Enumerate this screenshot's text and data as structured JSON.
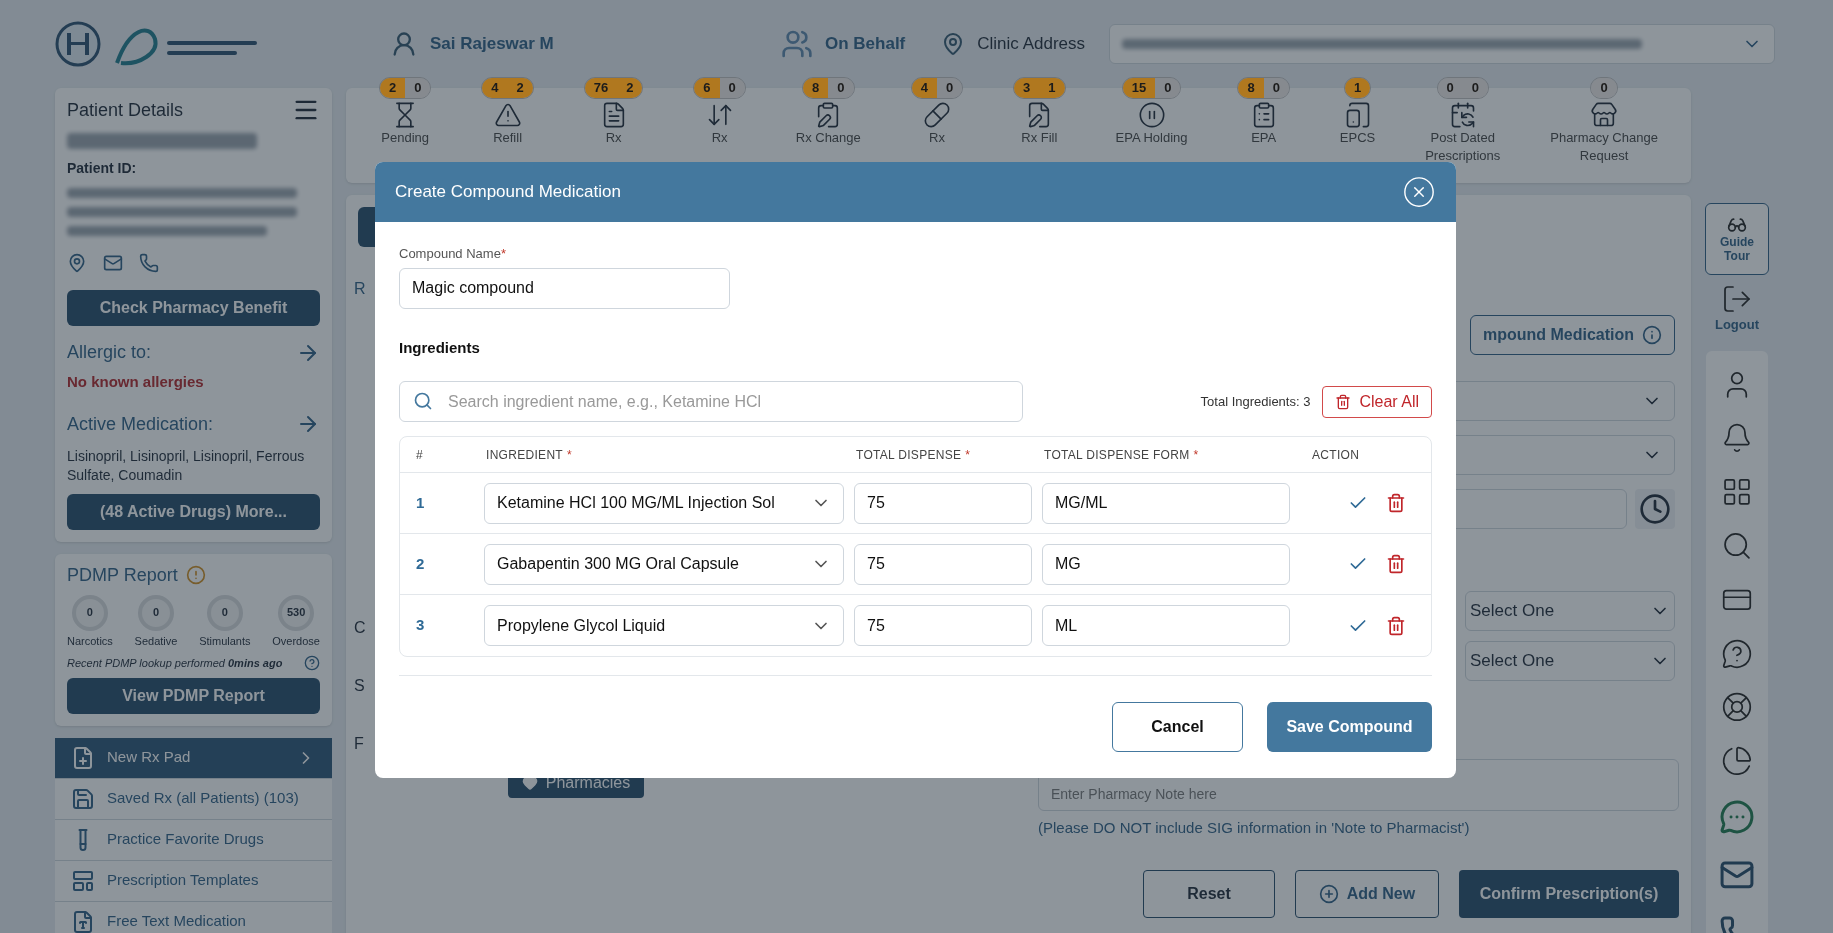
{
  "header": {
    "user": "Sai Rajeswar M",
    "on_behalf": "On Behalf",
    "clinic_label": "Clinic Address"
  },
  "toolbar": [
    {
      "lines": [
        "Pending"
      ],
      "badges": [
        {
          "value": "2",
          "color": "#b0781f"
        },
        {
          "value": "0",
          "color": "#868a8f"
        }
      ]
    },
    {
      "lines": [
        "Refill"
      ],
      "badges": [
        {
          "value": "4",
          "color": "#b0781f"
        },
        {
          "value": "2",
          "color": "#b0781f"
        }
      ]
    },
    {
      "lines": [
        "Rx"
      ],
      "badges": [
        {
          "value": "76",
          "color": "#b0781f"
        },
        {
          "value": "2",
          "color": "#b0781f"
        }
      ]
    },
    {
      "lines": [
        "Rx"
      ],
      "badges": [
        {
          "value": "6",
          "color": "#b0781f"
        },
        {
          "value": "0",
          "color": "#868a8f"
        }
      ]
    },
    {
      "lines": [
        "Rx Change"
      ],
      "badges": [
        {
          "value": "8",
          "color": "#b0781f"
        },
        {
          "value": "0",
          "color": "#868a8f"
        }
      ]
    },
    {
      "lines": [
        "Rx"
      ],
      "badges": [
        {
          "value": "4",
          "color": "#b0781f"
        },
        {
          "value": "0",
          "color": "#868a8f"
        }
      ]
    },
    {
      "lines": [
        "Rx Fill"
      ],
      "badges": [
        {
          "value": "3",
          "color": "#b0781f"
        },
        {
          "value": "1",
          "color": "#b0781f"
        }
      ]
    },
    {
      "lines": [
        "EPA Holding"
      ],
      "badges": [
        {
          "value": "15",
          "color": "#b0781f"
        },
        {
          "value": "0",
          "color": "#868a8f"
        }
      ]
    },
    {
      "lines": [
        "EPA"
      ],
      "badges": [
        {
          "value": "8",
          "color": "#b0781f"
        },
        {
          "value": "0",
          "color": "#868a8f"
        }
      ]
    },
    {
      "lines": [
        "EPCS"
      ],
      "badges": [
        {
          "value": "1",
          "color": "#b0781f"
        }
      ]
    },
    {
      "lines": [
        "Post Dated",
        "Prescriptions"
      ],
      "badges": [
        {
          "value": "0",
          "color": "#868a8f"
        },
        {
          "value": "0",
          "color": "#868a8f"
        }
      ]
    },
    {
      "lines": [
        "Pharmacy Change",
        "Request"
      ],
      "badges": [
        {
          "value": "0",
          "color": "#868a8f"
        }
      ]
    }
  ],
  "patient": {
    "title": "Patient Details",
    "id_label": "Patient ID:",
    "pharmacy_benefit": "Check Pharmacy Benefit",
    "allergic_label": "Allergic to:",
    "allergies": "No known allergies",
    "active_label": "Active Medication:",
    "medications": "Lisinopril, Lisinopril, Lisinopril, Ferrous Sulfate, Coumadin",
    "more": "(48 Active Drugs) More..."
  },
  "pdmp": {
    "title": "PDMP Report",
    "counters": [
      {
        "value": "0",
        "label": "Narcotics"
      },
      {
        "value": "0",
        "label": "Sedative"
      },
      {
        "value": "0",
        "label": "Stimulants"
      },
      {
        "value": "530",
        "label": "Overdose"
      }
    ],
    "lookup": "Recent PDMP lookup performed **0mins ago**",
    "button": "View PDMP Report"
  },
  "menu": [
    {
      "label": "New Rx Pad",
      "selected": true
    },
    {
      "label": "Saved Rx (all Patients) (103)",
      "selected": false
    },
    {
      "label": "Practice Favorite Drugs",
      "selected": false
    },
    {
      "label": "Prescription Templates",
      "selected": false
    },
    {
      "label": "Free Text Medication",
      "selected": false
    }
  ],
  "form": {
    "tab_fragment": "R",
    "compound_button": "mpound Medication",
    "label_fragments": [
      "C",
      "S",
      "F"
    ],
    "select_1": "Select One",
    "select_2": "Select One",
    "note_placeholder": "Enter Pharmacy Note here",
    "note_hint": "(Please DO NOT include SIG information in 'Note to Pharmacist')",
    "pharmacies": "Pharmacies",
    "reset": "Reset",
    "add_new": "Add New",
    "confirm": "Confirm Prescription(s)"
  },
  "rail": {
    "guide_tour": "Guide Tour",
    "logout": "Logout"
  },
  "modal": {
    "title": "Create Compound Medication",
    "name_label": "Compound Name",
    "required_mark": "*",
    "name_value": "Magic compound",
    "ingredients_title": "Ingredients",
    "search_placeholder": "Search ingredient name, e.g., Ketamine HCl",
    "total": "Total Ingredients: 3",
    "clear_all": "Clear All",
    "columns": [
      {
        "label": "#",
        "required": false
      },
      {
        "label": "INGREDIENT",
        "required": true
      },
      {
        "label": "TOTAL DISPENSE",
        "required": true
      },
      {
        "label": "TOTAL DISPENSE FORM",
        "required": true
      },
      {
        "label": "ACTION",
        "required": false
      }
    ],
    "rows": [
      {
        "index": "1",
        "ingredient": "Ketamine HCl 100 MG/ML Injection Sol",
        "dispense": "75",
        "form": "MG/ML"
      },
      {
        "index": "2",
        "ingredient": "Gabapentin 300 MG Oral Capsule",
        "dispense": "75",
        "form": "MG"
      },
      {
        "index": "3",
        "ingredient": "Propylene Glycol Liquid",
        "dispense": "75",
        "form": "ML"
      }
    ],
    "cancel": "Cancel",
    "save": "Save Compound"
  }
}
